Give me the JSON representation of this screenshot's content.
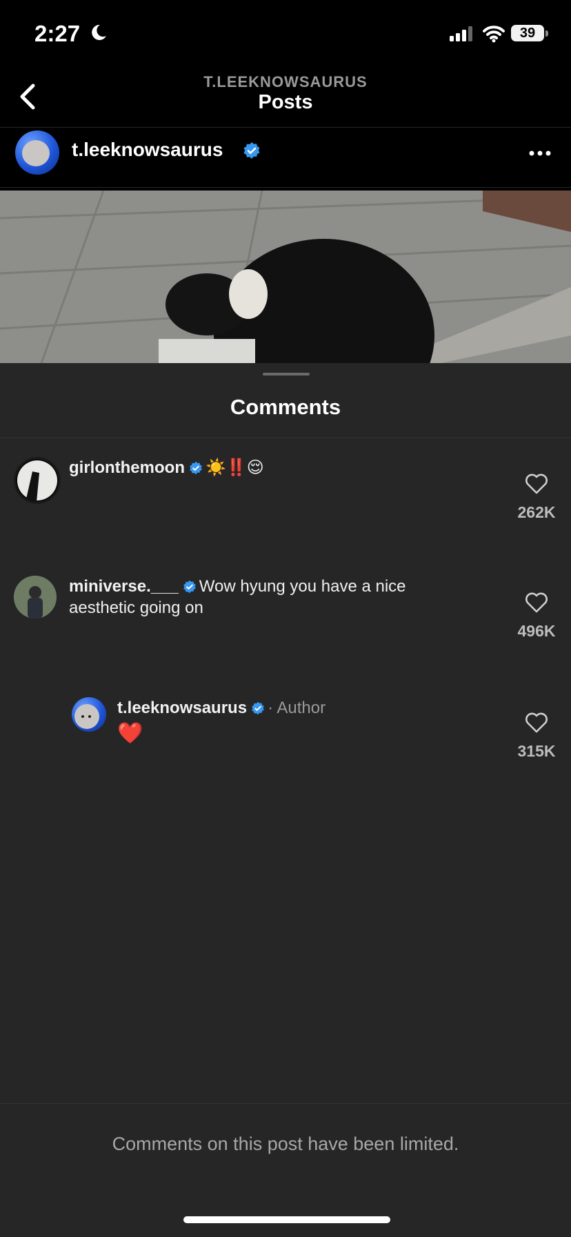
{
  "status_bar": {
    "time": "2:27",
    "battery": "39"
  },
  "nav": {
    "kicker": "T.LEEKNOWSAURUS",
    "title": "Posts"
  },
  "post": {
    "username": "t.leeknowsaurus",
    "more_icon": "ellipsis-icon"
  },
  "comments_sheet": {
    "title": "Comments",
    "comments": [
      {
        "username": "girlonthemoon",
        "text": "☀️‼️😌",
        "likes": "262K"
      },
      {
        "username": "miniverse.___",
        "text": "Wow hyung you have a nice aesthetic going on",
        "likes": "496K"
      },
      {
        "username": "t.leeknowsaurus",
        "author_label": "· Author",
        "text": "❤️",
        "likes": "315K"
      }
    ],
    "footer_note": "Comments on this post have been limited."
  },
  "colors": {
    "background": "#000000",
    "sheet": "#262626",
    "verified": "#3897f0",
    "muted": "#a8a8a8"
  }
}
